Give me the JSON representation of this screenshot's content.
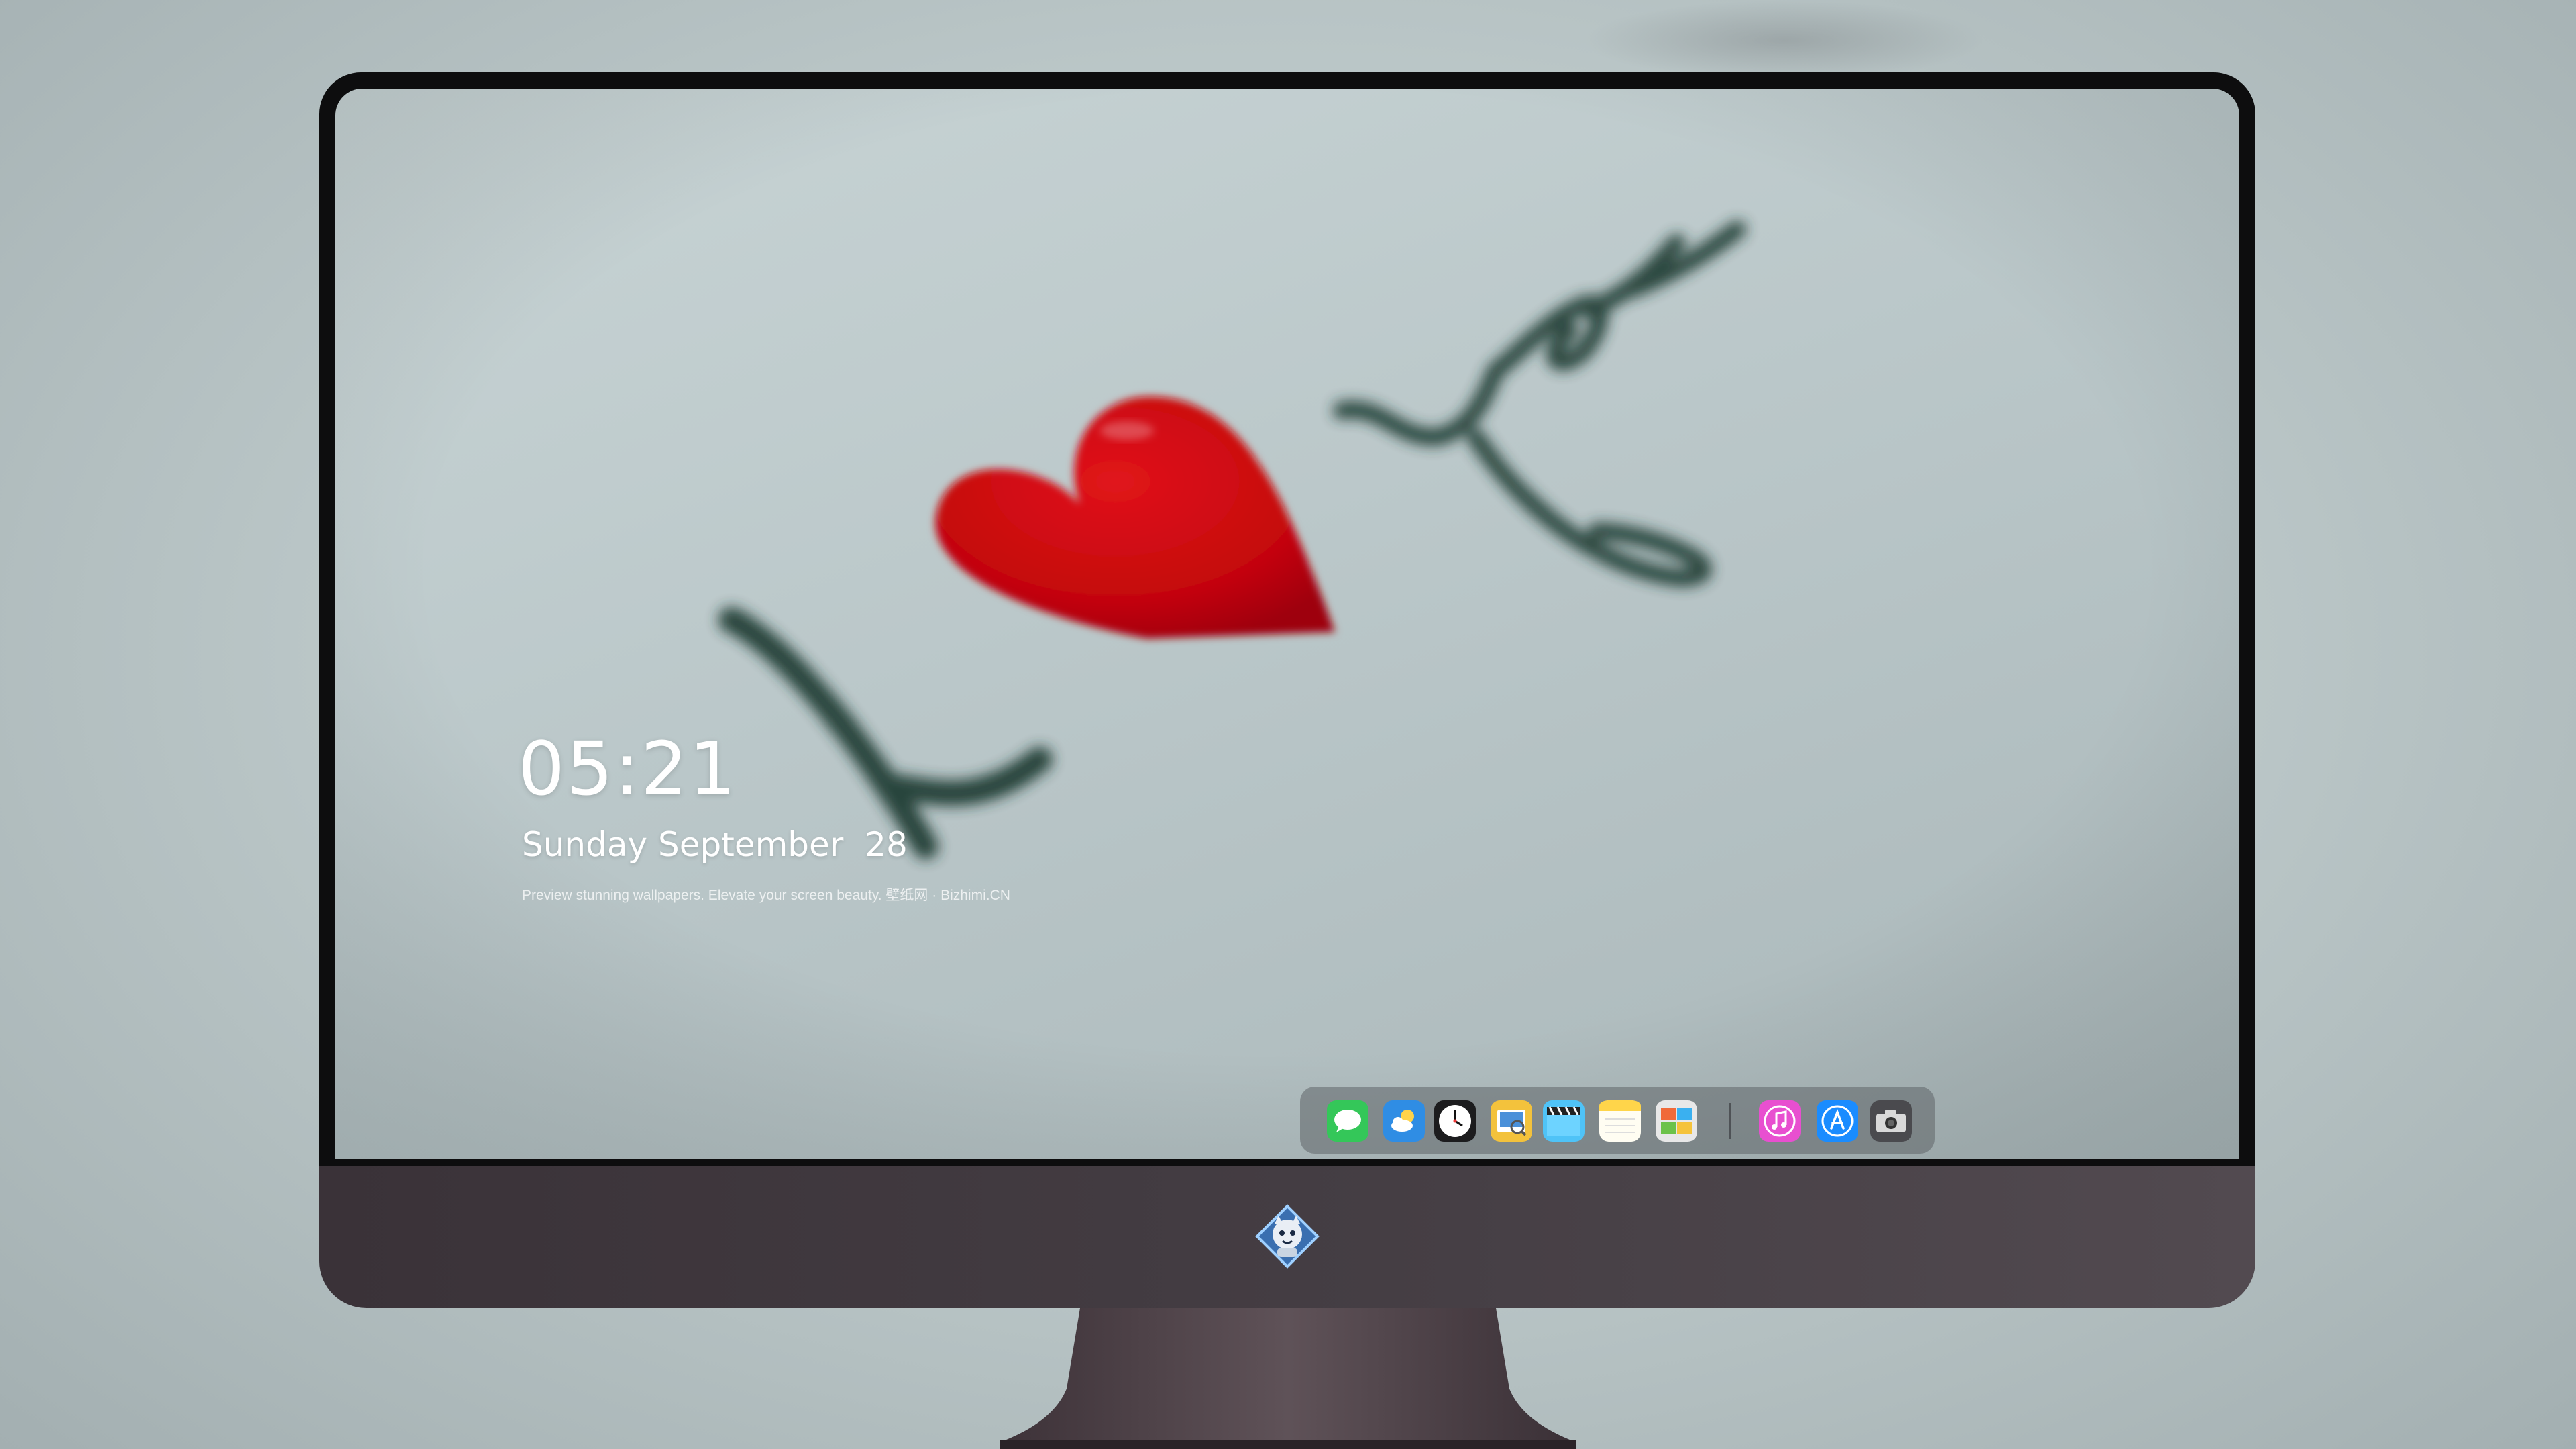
{
  "lockscreen": {
    "time": "05:21",
    "date": "Sunday September  28",
    "tagline": "Preview stunning wallpapers. Elevate your screen beauty. 壁纸网 · Bizhimi.CN"
  },
  "wallpaper": {
    "handwritten_text": [
      "I",
      "you"
    ],
    "heart_color": "#d1070e",
    "ink_color": "#1f3a33"
  },
  "dock": {
    "apps": [
      {
        "name": "messages-icon",
        "color": "#34c759"
      },
      {
        "name": "weather-icon",
        "color": "#2f8de4"
      },
      {
        "name": "clock-icon",
        "color": "#1c1c1e"
      },
      {
        "name": "preview-icon",
        "color": "#f3c23c"
      },
      {
        "name": "clips-icon",
        "color": "#4fc3f7"
      },
      {
        "name": "notes-icon",
        "color": "#ffd54a"
      },
      {
        "name": "photo-booth-icon",
        "color": "#e8e8e8"
      },
      {
        "name": "itunes-icon",
        "color": "#e84fd0"
      },
      {
        "name": "app-store-icon",
        "color": "#1a8cff"
      },
      {
        "name": "camera-icon",
        "color": "#4a4a4e"
      }
    ]
  },
  "colors": {
    "bezel": "#0d0d0e",
    "chin": "#453e44",
    "dock_bg": "#5f6468"
  }
}
